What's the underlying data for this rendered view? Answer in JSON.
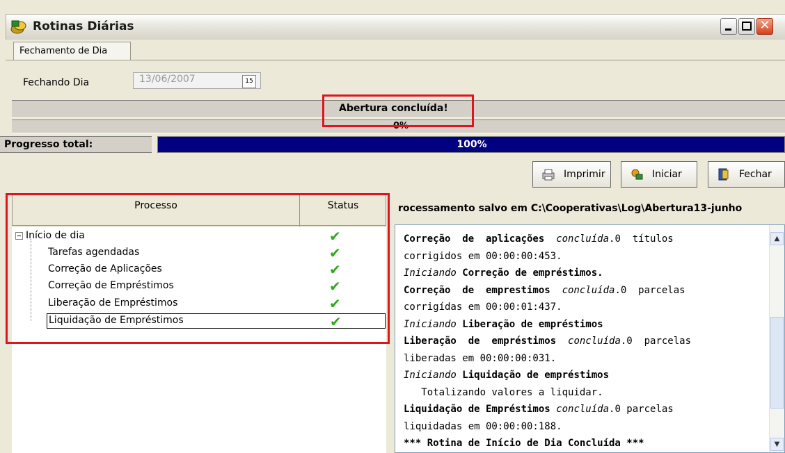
{
  "window": {
    "title": "Rotinas Diárias",
    "close_glyph": "✕"
  },
  "tabs": [
    "Fechamento de Dia"
  ],
  "form": {
    "fechando_label": "Fechando Dia",
    "date_value": "13/06/2007",
    "calendar_icon_text": "15"
  },
  "status_bars": {
    "message": "Abertura concluída!",
    "step_progress": "0%"
  },
  "progress": {
    "label": "Progresso total:",
    "percent_text": "100%",
    "value": 1.0
  },
  "buttons": {
    "print": "Imprimir",
    "start": "Iniciar",
    "close": "Fechar"
  },
  "grid": {
    "col_process": "Processo",
    "col_status": "Status",
    "root": "Início de dia",
    "items": [
      "Tarefas agendadas",
      "Correção de Aplicações",
      "Correção de Empréstimos",
      "Liberação de Empréstimos",
      "Liquidação de Empréstimos"
    ],
    "check_glyph": "✔"
  },
  "log": {
    "path": "rocessamento  salvo em C:\\Cooperativas\\Log\\Abertura13-junho",
    "lines": [
      "Correção  de  aplicações  concluída.0  títulos",
      "corrigidos em 00:00:00:453.",
      "Iniciando Correção de empréstimos.",
      "Correção  de  emprestimos  concluída.0  parcelas",
      "corrigídas em 00:00:01:437.",
      "Iniciando Liberação de empréstimos",
      "Liberação  de  empréstimos  concluída.0  parcelas",
      "liberadas em 00:00:00:031.",
      "Iniciando Liquidação de empréstimos",
      "   Totalizando valores a liquidar.",
      "Liquidação de Empréstimos concluída.0 parcelas",
      "liquidadas em 00:00:00:188.",
      "*** Rotina de Início de Dia Concluída ***"
    ]
  },
  "colors": {
    "progress_fill": "#000080",
    "check": "#2eaa1a",
    "highlight_border": "#e0141e"
  }
}
